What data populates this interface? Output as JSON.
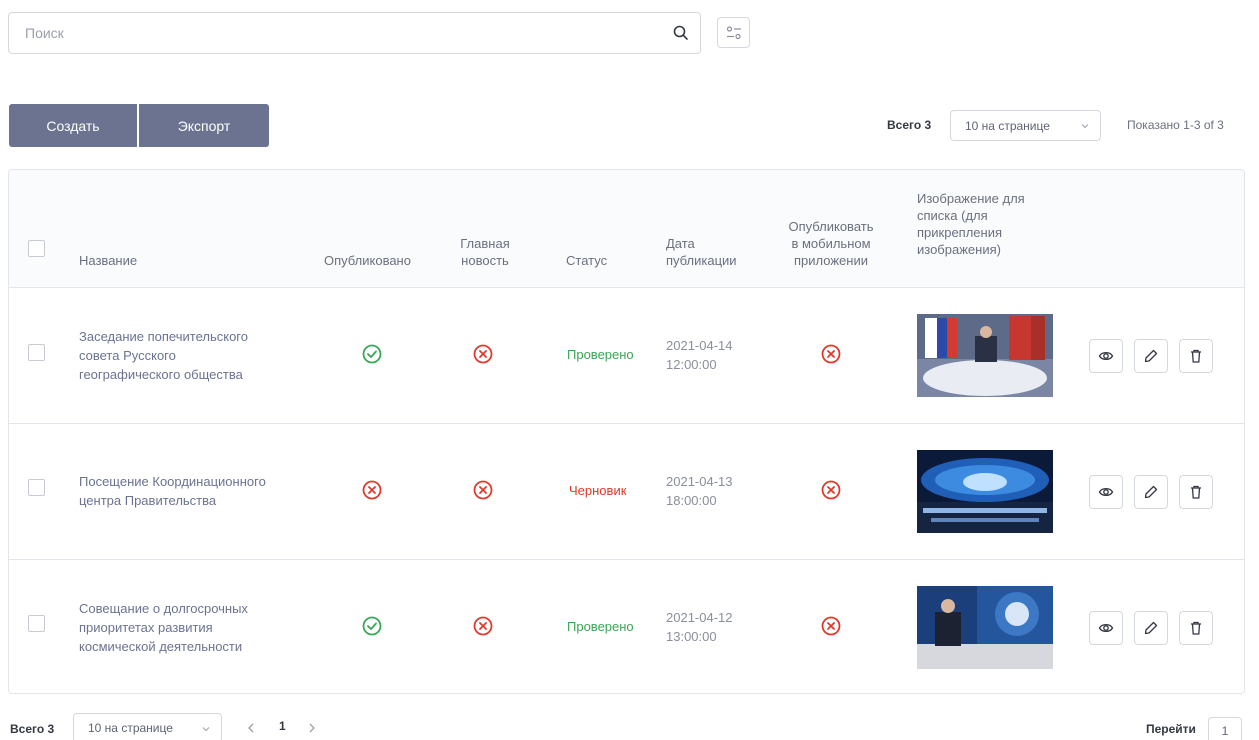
{
  "search": {
    "placeholder": "Поиск"
  },
  "toolbar": {
    "create_label": "Создать",
    "export_label": "Экспорт",
    "total_label": "Всего 3",
    "page_size": "10 на странице",
    "shown_label": "Показано 1-3 of 3"
  },
  "table": {
    "columns": {
      "title": "Название",
      "published": "Опубликовано",
      "main_news": [
        "Главная",
        "новость"
      ],
      "status": "Статус",
      "pub_date": [
        "Дата",
        "публикации"
      ],
      "mobile": [
        "Опубликовать",
        "в мобильном",
        "приложении"
      ],
      "image": [
        "Изображение для",
        "списка (для",
        "прикрепления",
        "изображения)"
      ]
    },
    "rows": [
      {
        "title": [
          "Заседание попечительского",
          "совета Русского",
          "географического общества"
        ],
        "published": true,
        "main_news": false,
        "status": "Проверено",
        "date": "2021-04-14",
        "time": "12:00:00",
        "mobile": false
      },
      {
        "title": [
          "Посещение Координационного",
          "центра Правительства"
        ],
        "published": false,
        "main_news": false,
        "status": "Черновик",
        "date": "2021-04-13",
        "time": "18:00:00",
        "mobile": false
      },
      {
        "title": [
          "Совещание о долгосрочных",
          "приоритетах развития",
          "космической деятельности"
        ],
        "published": true,
        "main_news": false,
        "status": "Проверено",
        "date": "2021-04-12",
        "time": "13:00:00",
        "mobile": false
      }
    ]
  },
  "footer": {
    "total_label": "Всего 3",
    "page_size": "10 на странице",
    "current_page": "1",
    "goto_label": "Перейти",
    "goto_value": "1"
  },
  "colors": {
    "primary_button": "#6b7391",
    "ok": "#3aa655",
    "error": "#e0392b",
    "title_link": "#6b7391"
  }
}
